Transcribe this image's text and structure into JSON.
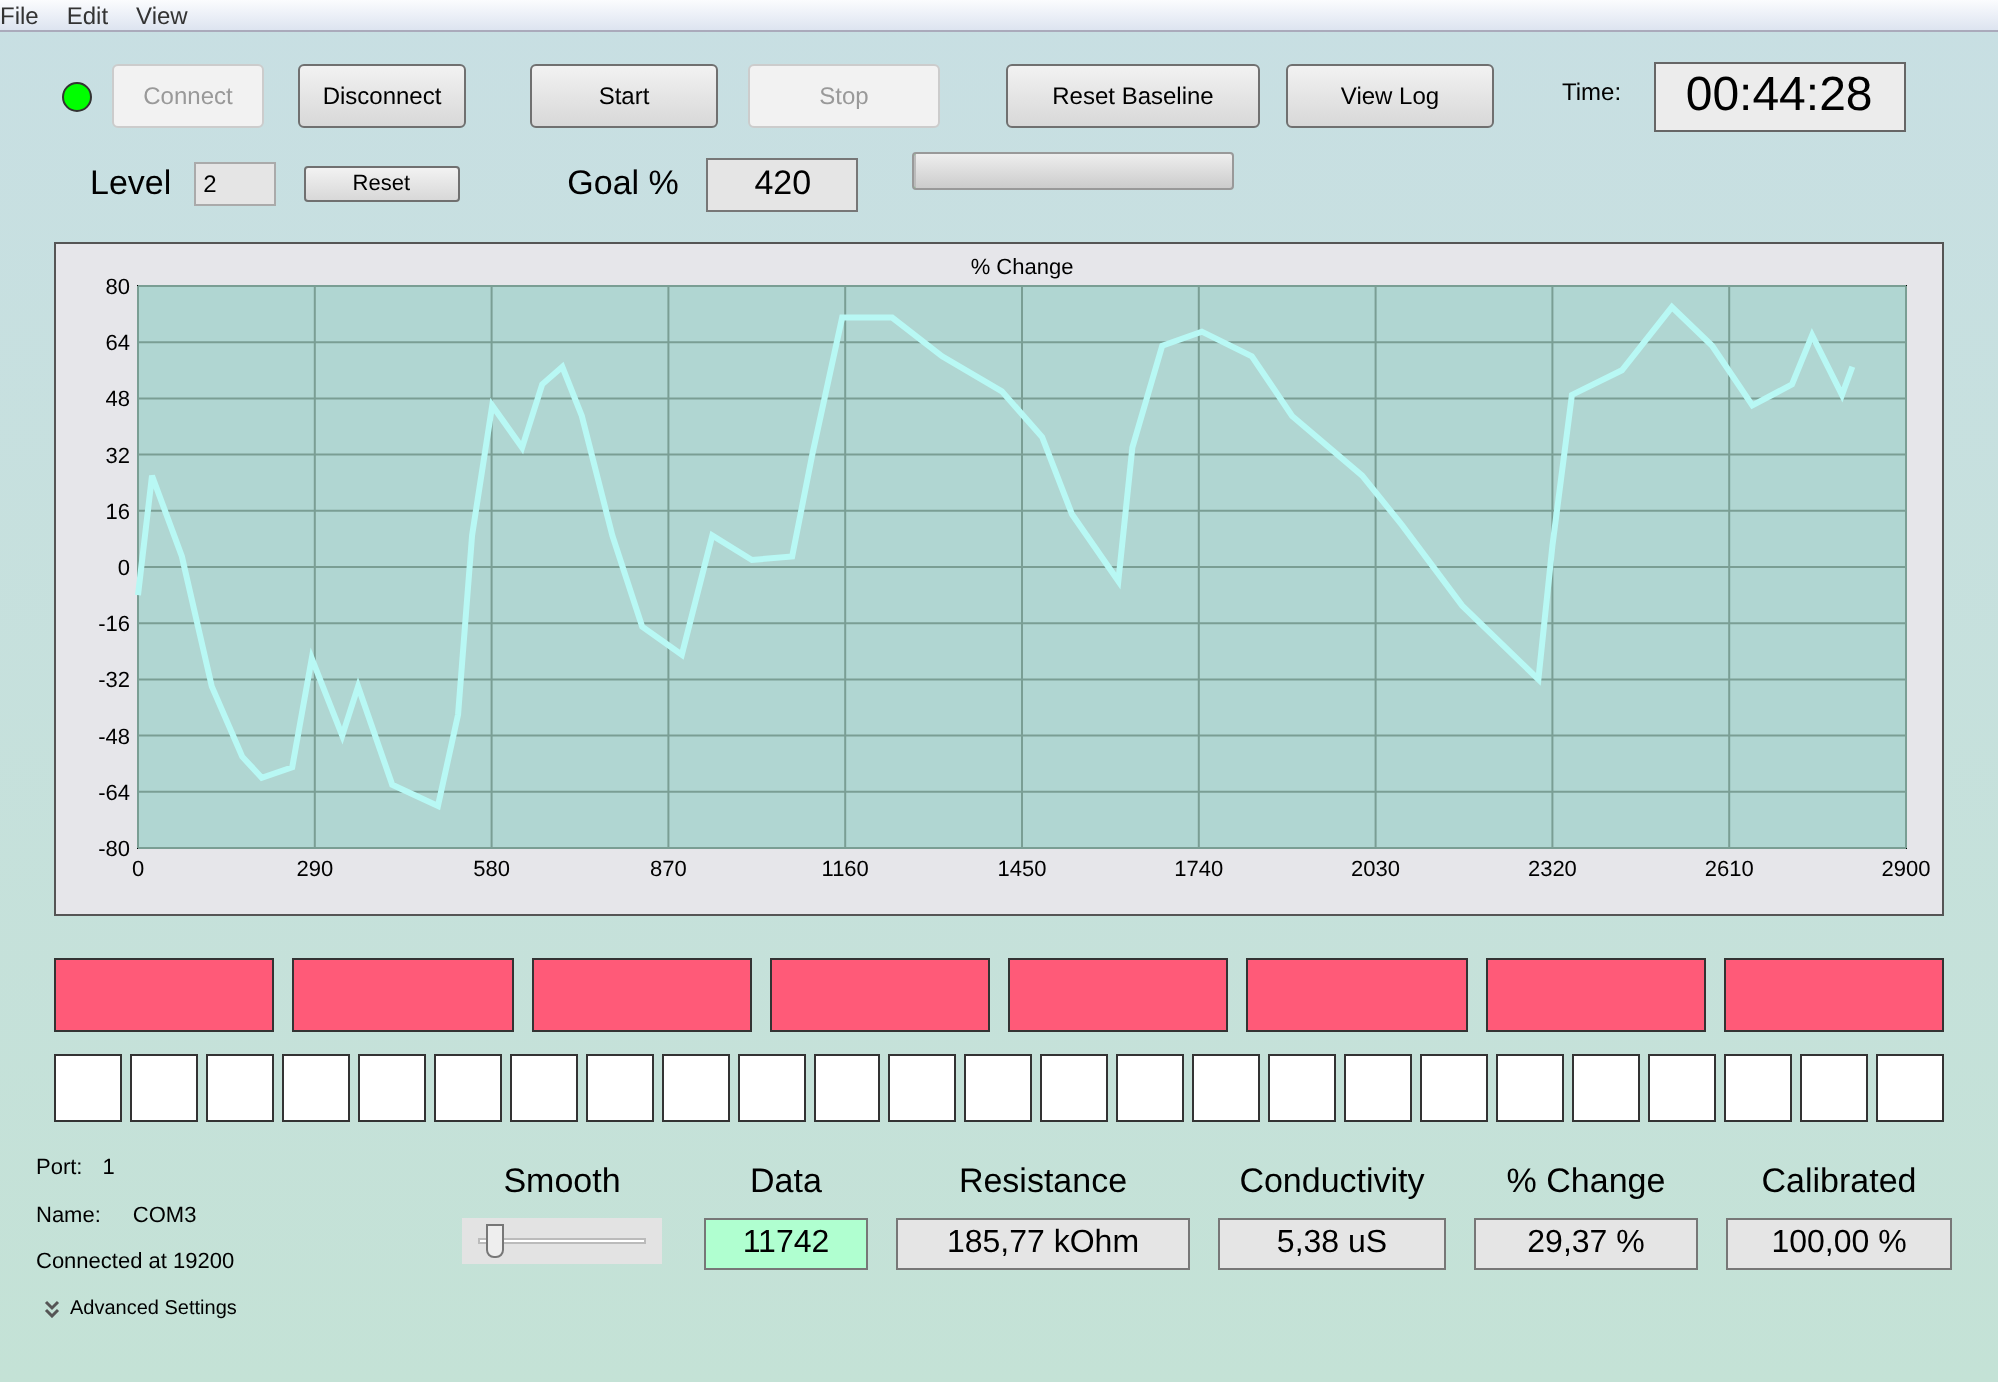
{
  "menu": [
    "File",
    "Edit",
    "View"
  ],
  "status_led": {
    "on": true
  },
  "buttons": [
    {
      "label": "Connect",
      "disabled": true
    },
    {
      "label": "Disconnect",
      "disabled": false
    },
    {
      "label": "Start",
      "disabled": false
    },
    {
      "label": "Stop",
      "disabled": true
    },
    {
      "label": "Reset Baseline",
      "disabled": false
    },
    {
      "label": "View Log",
      "disabled": false
    }
  ],
  "time": {
    "label": "Time:",
    "value": "00:44:28"
  },
  "level": {
    "label": "Level",
    "value": "2",
    "reset": "Reset"
  },
  "goal": {
    "label": "Goal %",
    "value": "420"
  },
  "progress": {
    "level": 0
  },
  "chart_data": {
    "type": "line",
    "title": "% Change",
    "xlim": [
      0,
      2900
    ],
    "ylim": [
      -80,
      80
    ],
    "xticks": [
      0,
      290,
      580,
      870,
      1160,
      1450,
      1740,
      2030,
      2320,
      2610,
      2900
    ],
    "yticks": [
      -80,
      -64,
      -48,
      -32,
      -16,
      0,
      16,
      32,
      48,
      64,
      80
    ],
    "x": [
      0,
      23,
      72,
      121,
      171,
      203,
      253,
      285,
      335,
      361,
      417,
      492,
      525,
      548,
      581,
      630,
      663,
      696,
      728,
      778,
      827,
      892,
      942,
      1007,
      1073,
      1106,
      1155,
      1237,
      1319,
      1417,
      1483,
      1532,
      1608,
      1631,
      1680,
      1745,
      1827,
      1893,
      2008,
      2073,
      2172,
      2297,
      2320,
      2352,
      2434,
      2516,
      2582,
      2648,
      2713,
      2746,
      2795,
      2812
    ],
    "grid": true,
    "series": [
      {
        "color": "#b8f8f4",
        "values": [
          -8,
          26,
          3,
          -34,
          -54,
          -60,
          -57,
          -26,
          -48,
          -34,
          -62,
          -68,
          -42,
          9,
          46,
          34,
          52,
          57,
          43,
          9,
          -17,
          -25,
          9,
          2,
          3,
          32,
          71,
          71,
          60,
          50,
          37,
          15,
          -4,
          34,
          63,
          67,
          60,
          43,
          26,
          12,
          -11,
          -32,
          6,
          49,
          56,
          74,
          63,
          46,
          52,
          66,
          49,
          57
        ]
      }
    ]
  },
  "indicator_rows": [
    [
      {
        "lit": true
      },
      {
        "lit": true
      },
      {
        "lit": true
      },
      {
        "lit": true
      },
      {
        "lit": true
      },
      {
        "lit": true
      },
      {
        "lit": true
      },
      {
        "lit": true
      }
    ],
    [
      {
        "lit": false
      },
      {
        "lit": false
      },
      {
        "lit": false
      },
      {
        "lit": false
      },
      {
        "lit": false
      },
      {
        "lit": false
      },
      {
        "lit": false
      },
      {
        "lit": false
      },
      {
        "lit": false
      },
      {
        "lit": false
      },
      {
        "lit": false
      },
      {
        "lit": false
      },
      {
        "lit": false
      },
      {
        "lit": false
      },
      {
        "lit": false
      },
      {
        "lit": false
      },
      {
        "lit": false
      },
      {
        "lit": false
      },
      {
        "lit": false
      },
      {
        "lit": false
      },
      {
        "lit": false
      },
      {
        "lit": false
      },
      {
        "lit": false
      },
      {
        "lit": false
      },
      {
        "lit": false
      }
    ]
  ],
  "port_info": {
    "port_label": "Port:",
    "port": "1",
    "name_label": "Name:",
    "name": "COM3",
    "connection": "Connected at 19200",
    "advanced": "Advanced Settings"
  },
  "smooth": {
    "label": "Smooth",
    "level": 0.05
  },
  "readouts": [
    {
      "label": "Data",
      "value": "11742",
      "highlight": true
    },
    {
      "label": "Resistance",
      "value": "185,77 kOhm",
      "highlight": false
    },
    {
      "label": "Conductivity",
      "value": "5,38 uS",
      "highlight": false
    },
    {
      "label": "% Change",
      "value": "29,37 %",
      "highlight": false
    },
    {
      "label": "Calibrated",
      "value": "100,00 %",
      "highlight": false
    }
  ]
}
